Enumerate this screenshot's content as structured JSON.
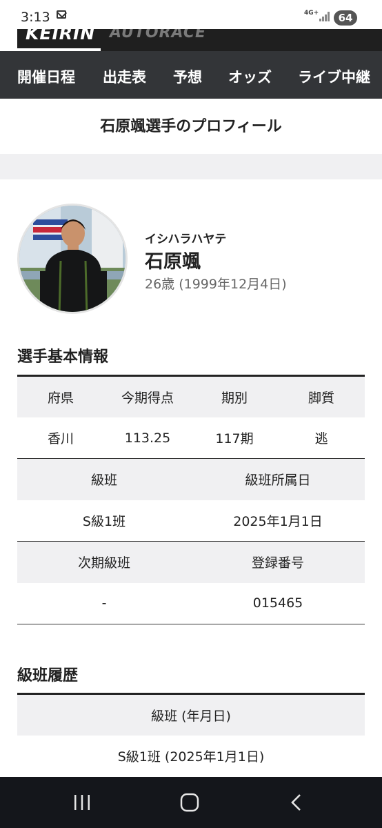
{
  "status_bar": {
    "time": "3:13",
    "network": "4G+",
    "battery": "64"
  },
  "brand": {
    "keirin": "KEIRIN",
    "autorace": "AUTORACE"
  },
  "nav": {
    "items": [
      "開催日程",
      "出走表",
      "予想",
      "オッズ",
      "ライブ中継"
    ]
  },
  "page": {
    "title": "石原颯選手のプロフィール"
  },
  "profile": {
    "kana": "イシハラハヤテ",
    "name": "石原颯",
    "age": "26歳 (1999年12月4日)"
  },
  "basic_info": {
    "heading": "選手基本情報",
    "row1_headers": [
      "府県",
      "今期得点",
      "期別",
      "脚質"
    ],
    "row1_values": [
      "香川",
      "113.25",
      "117期",
      "逃"
    ],
    "row2_headers": [
      "級班",
      "級班所属日"
    ],
    "row2_values": [
      "S級1班",
      "2025年1月1日"
    ],
    "row3_headers": [
      "次期級班",
      "登録番号"
    ],
    "row3_values": [
      "-",
      "015465"
    ]
  },
  "rank_history": {
    "heading": "級班履歴",
    "header": "級班 (年月日)",
    "entries": [
      "S級1班 (2025年1月1日)"
    ]
  },
  "colors": {
    "nav_bg": "#333538",
    "brand_bg": "#1f1f1f",
    "table_header_bg": "#f0f0f2",
    "system_nav_bg": "#14161b"
  }
}
